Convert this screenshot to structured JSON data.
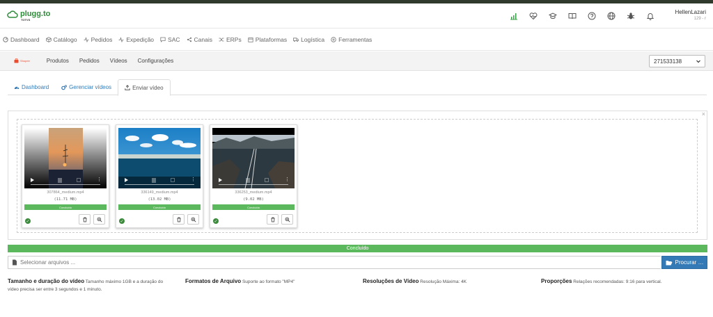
{
  "header": {
    "logo_text": "plugg.to",
    "logo_sub": "TOTVS",
    "user_name": "HellenLazari",
    "user_id": "129 - r",
    "icons": [
      "chart-icon",
      "heartbeat-icon",
      "graduation-cap-icon",
      "book-icon",
      "help-icon",
      "globe-icon",
      "bug-icon",
      "bell-icon"
    ]
  },
  "mainnav": {
    "items": [
      {
        "label": "Dashboard",
        "icon": "dashboard-icon"
      },
      {
        "label": "Catálogo",
        "icon": "cube-icon"
      },
      {
        "label": "Pedidos",
        "icon": "activity-icon"
      },
      {
        "label": "Expedição",
        "icon": "activity-icon"
      },
      {
        "label": "SAC",
        "icon": "chat-icon"
      },
      {
        "label": "Canais",
        "icon": "share-icon"
      },
      {
        "label": "ERPs",
        "icon": "shuffle-icon"
      },
      {
        "label": "Plataformas",
        "icon": "calendar-icon"
      },
      {
        "label": "Logística",
        "icon": "truck-icon"
      },
      {
        "label": "Ferramentas",
        "icon": "plus-circle-icon"
      }
    ]
  },
  "subnav": {
    "brand": "Shopee",
    "links": [
      "Produtos",
      "Pedidos",
      "Vídeos",
      "Configurações"
    ],
    "store_value": "271533138"
  },
  "tabs": [
    {
      "label": "Dashboard"
    },
    {
      "label": "Gerenciar vídeos"
    },
    {
      "label": "Enviar vídeo"
    }
  ],
  "videos": [
    {
      "filename": "307864_medium.mp4",
      "size": "(11.71 MB)",
      "status": "Concluído"
    },
    {
      "filename": "336149_medium.mp4",
      "size": "(13.02 MB)",
      "status": "Concluído"
    },
    {
      "filename": "336253_medium.mp4",
      "size": "(9.02 MB)",
      "status": "Concluído"
    }
  ],
  "upload": {
    "progress_label": "Concluído",
    "progress": 1.0,
    "placeholder": "Selecionar arquivos ...",
    "browse_label": "Procurar …"
  },
  "info": [
    {
      "title": "Tamanho e duração do vídeo",
      "text": "Tamanho máximo 1GB e a duração do vídeo precisa ser entre 3 segundos e 1 minuto."
    },
    {
      "title": "Formatos de Arquivo",
      "text": "Suporte ao formato \"MP4\""
    },
    {
      "title": "Resoluções de Vídeo",
      "text": "Resolução Máxima: 4K"
    },
    {
      "title": "Proporções",
      "text": "Relações recomendadas: 9:16 para vertical."
    }
  ],
  "colors": {
    "brand_green": "#2e8b3a",
    "success": "#5cb85c",
    "primary": "#337ab7",
    "shopee": "#ee4d2d"
  }
}
